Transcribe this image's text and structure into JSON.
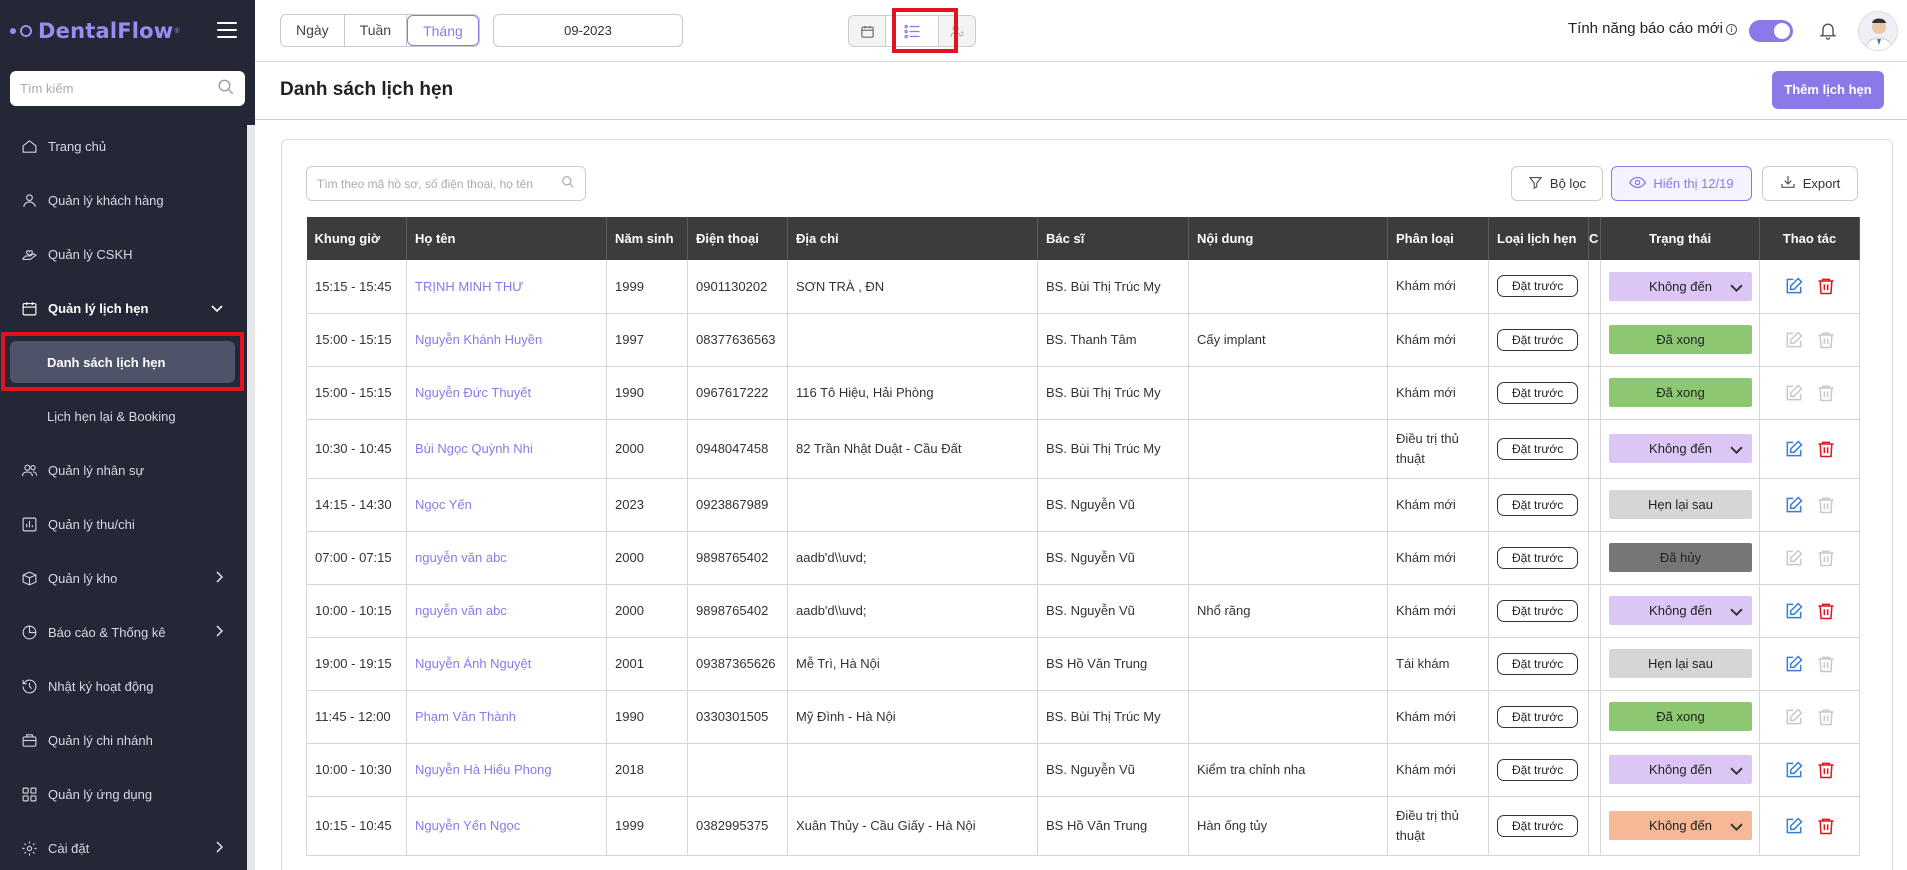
{
  "app": {
    "logo_text": "DentalFlow",
    "logo_reg": "®"
  },
  "sidebar": {
    "search_placeholder": "Tìm kiếm",
    "items": [
      {
        "label": "Trang chủ",
        "icon": "home-icon"
      },
      {
        "label": "Quản lý khách hàng",
        "icon": "user-icon"
      },
      {
        "label": "Quản lý CSKH",
        "icon": "hand-heart-icon"
      },
      {
        "label": "Quản lý lịch hẹn",
        "icon": "calendar-icon",
        "expanded": true
      },
      {
        "label": "Quản lý nhân sự",
        "icon": "users-icon"
      },
      {
        "label": "Quản lý thu/chi",
        "icon": "chart-icon"
      },
      {
        "label": "Quản lý kho",
        "icon": "box-icon"
      },
      {
        "label": "Báo cáo & Thống kê",
        "icon": "report-icon"
      },
      {
        "label": "Nhật ký hoạt động",
        "icon": "history-icon"
      },
      {
        "label": "Quản lý chi nhánh",
        "icon": "briefcase-icon"
      },
      {
        "label": "Quản lý ứng dụng",
        "icon": "apps-icon"
      },
      {
        "label": "Cài đặt",
        "icon": "settings-icon"
      }
    ],
    "sub_items": [
      {
        "label": "Danh sách lịch hẹn",
        "active": true
      },
      {
        "label": "Lịch hẹn lại & Booking",
        "active": false
      }
    ]
  },
  "topbar": {
    "periods": [
      "Ngày",
      "Tuần",
      "Tháng"
    ],
    "active_period": "Tháng",
    "month_value": "09-2023",
    "report_toggle_label": "Tính năng báo cáo mới",
    "report_toggle_on": true
  },
  "page": {
    "title": "Danh sách lịch hẹn",
    "add_button": "Thêm lịch hẹn",
    "search_placeholder": "Tìm theo mã hồ sơ, số điện thoại, họ tên",
    "filter_button": "Bộ lọc",
    "display_button": "Hiển thị 12/19",
    "export_button": "Export"
  },
  "table": {
    "columns": [
      "Khung giờ",
      "Họ tên",
      "Năm sinh",
      "Điện thoại",
      "Địa chỉ",
      "Bác sĩ",
      "Nội dung",
      "Phân loại",
      "Loại lịch hẹn",
      "C",
      "Trạng thái",
      "Thao tác"
    ],
    "rows": [
      {
        "time": "15:15 - 15:45",
        "name": "TRỊNH MINH THƯ",
        "year": "1999",
        "phone": "0901130202",
        "address": "SƠN TRÀ , ĐN",
        "doctor": "BS. Bùi Thị Trúc My",
        "content": "",
        "category": "Khám mới",
        "type": "Đặt trước",
        "status": "Không đến",
        "status_color": "#dcc6f5",
        "dropdown": true,
        "editable": true,
        "deletable": true
      },
      {
        "time": "15:00 - 15:15",
        "name": "Nguyễn Khánh Huyền",
        "year": "1997",
        "phone": "08377636563",
        "address": "",
        "doctor": "BS. Thanh Tâm",
        "content": "Cấy implant",
        "category": "Khám mới",
        "type": "Đặt trước",
        "status": "Đã xong",
        "status_color": "#8cc872",
        "dropdown": false,
        "editable": false,
        "deletable": false
      },
      {
        "time": "15:00 - 15:15",
        "name": "Nguyễn Đức Thuyết",
        "year": "1990",
        "phone": "0967617222",
        "address": "116 Tô Hiệu, Hải Phòng",
        "doctor": "BS. Bùi Thị Trúc My",
        "content": "",
        "category": "Khám mới",
        "type": "Đặt trước",
        "status": "Đã xong",
        "status_color": "#8cc872",
        "dropdown": false,
        "editable": false,
        "deletable": false
      },
      {
        "time": "10:30 - 10:45",
        "name": "Bùi Ngọc Quỳnh Nhi",
        "year": "2000",
        "phone": "0948047458",
        "address": "82 Trần Nhật Duật - Cầu Đất",
        "doctor": "BS. Bùi Thị Trúc My",
        "content": "",
        "category": "Điều trị thủ thuật",
        "type": "Đặt trước",
        "status": "Không đến",
        "status_color": "#dcc6f5",
        "dropdown": true,
        "editable": true,
        "deletable": true
      },
      {
        "time": "14:15 - 14:30",
        "name": "Ngọc Yến",
        "year": "2023",
        "phone": "0923867989",
        "address": "",
        "doctor": "BS. Nguyễn Vũ",
        "content": "",
        "category": "Khám mới",
        "type": "Đặt trước",
        "status": "Hẹn lại sau",
        "status_color": "#d6d6d6",
        "dropdown": false,
        "editable": true,
        "deletable": false
      },
      {
        "time": "07:00 - 07:15",
        "name": "nguyễn văn abc",
        "year": "2000",
        "phone": "9898765402",
        "address": "aadb'd\\\\uvd;",
        "doctor": "BS. Nguyễn Vũ",
        "content": "",
        "category": "Khám mới",
        "type": "Đặt trước",
        "status": "Đã hủy",
        "status_color": "#767676",
        "dropdown": false,
        "editable": false,
        "deletable": false
      },
      {
        "time": "10:00 - 10:15",
        "name": "nguyễn văn abc",
        "year": "2000",
        "phone": "9898765402",
        "address": "aadb'd\\\\uvd;",
        "doctor": "BS. Nguyễn Vũ",
        "content": "Nhổ răng",
        "category": "Khám mới",
        "type": "Đặt trước",
        "status": "Không đến",
        "status_color": "#dcc6f5",
        "dropdown": true,
        "editable": true,
        "deletable": true
      },
      {
        "time": "19:00 - 19:15",
        "name": "Nguyễn Ánh Nguyệt",
        "year": "2001",
        "phone": "09387365626",
        "address": "Mễ Trì, Hà Nội",
        "doctor": "BS Hồ Văn Trung",
        "content": "",
        "category": "Tái khám",
        "type": "Đặt trước",
        "status": "Hẹn lại sau",
        "status_color": "#d6d6d6",
        "dropdown": false,
        "editable": true,
        "deletable": false
      },
      {
        "time": "11:45 - 12:00",
        "name": "Phạm Văn Thành",
        "year": "1990",
        "phone": "0330301505",
        "address": "Mỹ Đình - Hà Nội",
        "doctor": "BS. Bùi Thị Trúc My",
        "content": "",
        "category": "Khám mới",
        "type": "Đặt trước",
        "status": "Đã xong",
        "status_color": "#8cc872",
        "dropdown": false,
        "editable": false,
        "deletable": false
      },
      {
        "time": "10:00 - 10:30",
        "name": "Nguyễn Hà Hiếu Phong",
        "year": "2018",
        "phone": "",
        "address": "",
        "doctor": "BS. Nguyễn Vũ",
        "content": "Kiểm tra chỉnh nha",
        "category": "Khám mới",
        "type": "Đặt trước",
        "status": "Không đến",
        "status_color": "#dcc6f5",
        "dropdown": true,
        "editable": true,
        "deletable": true
      },
      {
        "time": "10:15 - 10:45",
        "name": "Nguyễn Yến Ngọc",
        "year": "1999",
        "phone": "0382995375",
        "address": "Xuân Thủy - Cầu Giấy - Hà Nội",
        "doctor": "BS Hồ Văn Trung",
        "content": "Hàn ống tủy",
        "category": "Điều trị thủ thuật",
        "type": "Đặt trước",
        "status": "Không đến",
        "status_color": "#f6b896",
        "dropdown": true,
        "editable": true,
        "deletable": true
      }
    ]
  },
  "colors": {
    "accent": "#8a7ae8",
    "sidebar_bg": "#242836",
    "highlight_border": "#e0141e",
    "edit_icon": "#3a7bd5",
    "delete_icon": "#e0141e",
    "disabled_icon": "#c8c8c8"
  }
}
